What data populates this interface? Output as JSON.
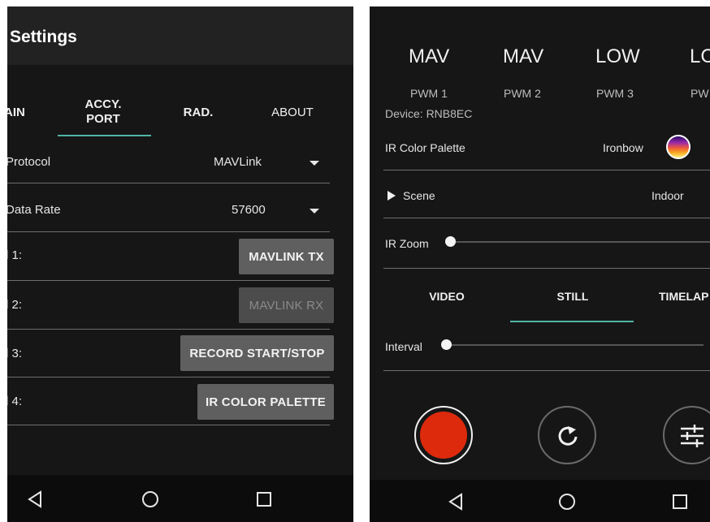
{
  "left": {
    "title": "Settings",
    "tabs": [
      {
        "label": "AIN"
      },
      {
        "label": "ACCY.\nPORT",
        "active": true
      },
      {
        "label": "RAD."
      },
      {
        "label": "ABOUT"
      }
    ],
    "rows": [
      {
        "label": "Protocol",
        "value": "MAVLink"
      },
      {
        "label": "Data Rate",
        "value": "57600"
      }
    ],
    "channels": [
      {
        "label": "l 1:",
        "button": "MAVLINK TX",
        "disabled": false
      },
      {
        "label": "l 2:",
        "button": "MAVLINK RX",
        "disabled": true
      },
      {
        "label": "l 3:",
        "button": "RECORD START/STOP",
        "disabled": false
      },
      {
        "label": "l 4:",
        "button": "IR COLOR PALETTE",
        "disabled": false
      }
    ]
  },
  "right": {
    "pwm_values": [
      "MAV",
      "MAV",
      "LOW",
      "LC"
    ],
    "pwm_labels": [
      "PWM 1",
      "PWM 2",
      "PWM 3",
      "PW"
    ],
    "device": "Device: RNB8EC",
    "palette_label": "IR Color Palette",
    "palette_value": "Ironbow",
    "scene_label": "Scene",
    "scene_value": "Indoor",
    "zoom_label": "IR Zoom",
    "zoom_level": 0,
    "mode_tabs": [
      {
        "label": "VIDEO"
      },
      {
        "label": "STILL",
        "active": true
      },
      {
        "label": "TIMELAP"
      }
    ],
    "interval_label": "Interval",
    "interval_level": 0
  },
  "colors": {
    "accent": "#4fb6a6",
    "record": "#dd2a0c",
    "background": "#161616",
    "titlebar": "#222222",
    "button": "#5f5f5f"
  },
  "icons": {
    "back": "back-triangle-icon",
    "home": "home-circle-icon",
    "recents": "recents-square-icon",
    "record": "record-icon",
    "refresh": "refresh-icon",
    "settings": "sliders-icon",
    "palette": "ironbow-palette-icon",
    "scene": "play-triangle-icon",
    "dropdown": "caret-down-icon"
  }
}
